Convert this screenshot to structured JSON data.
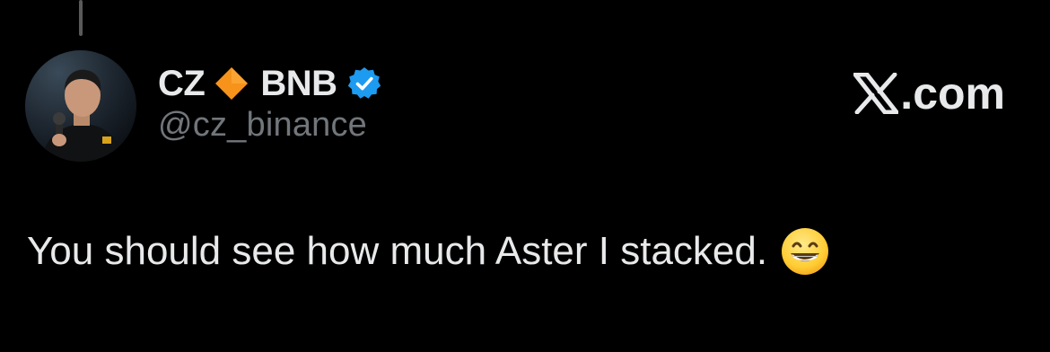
{
  "author": {
    "display_name": "CZ",
    "name_suffix": "BNB",
    "handle": "@cz_binance",
    "avatar_icon": "profile-photo"
  },
  "brand": {
    "label": ".com",
    "logo_icon": "x-logo-icon"
  },
  "tweet": {
    "text": "You should see how much Aster I stacked.",
    "emoji_icon": "grinning-face-emoji"
  },
  "colors": {
    "background": "#000000",
    "primary_text": "#e7e9ea",
    "secondary_text": "#71767b",
    "verified_badge": "#1d9bf0",
    "diamond": "#f7931a"
  }
}
